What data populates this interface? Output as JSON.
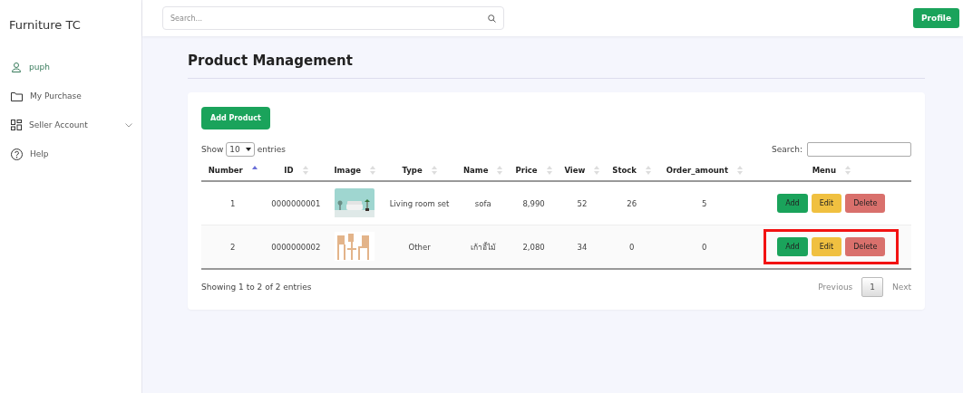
{
  "brand": "Furniture TC",
  "sidebar": {
    "items": [
      {
        "label": "puph",
        "selected": true,
        "expandable": false
      },
      {
        "label": "My Purchase",
        "selected": false,
        "expandable": false
      },
      {
        "label": "Seller Account",
        "selected": false,
        "expandable": true
      },
      {
        "label": "Help",
        "selected": false,
        "expandable": false
      }
    ]
  },
  "topbar": {
    "search_placeholder": "Search...",
    "profile_button": "Profile"
  },
  "page_title": "Product Management",
  "add_button": "Add Product",
  "length_menu": {
    "show": "Show",
    "value": "10",
    "entries": "entries"
  },
  "table_search_label": "Search:",
  "table": {
    "columns": [
      {
        "label": "Number",
        "sorted_ascending": true
      },
      {
        "label": "ID",
        "sorted_ascending": false
      },
      {
        "label": "Image",
        "sorted_ascending": false
      },
      {
        "label": "Type",
        "sorted_ascending": false
      },
      {
        "label": "Name",
        "sorted_ascending": false
      },
      {
        "label": "Price",
        "sorted_ascending": false
      },
      {
        "label": "View",
        "sorted_ascending": false
      },
      {
        "label": "Stock",
        "sorted_ascending": false
      },
      {
        "label": "Order_amount",
        "sorted_ascending": false
      },
      {
        "label": "Menu",
        "sorted_ascending": false
      }
    ],
    "rows": [
      {
        "number": "1",
        "id": "0000000001",
        "image": {
          "kind": "picture"
        },
        "type": "Living room set",
        "name": "sofa",
        "price": "8,990",
        "view": "52",
        "stock": "26",
        "order_amount": "5",
        "actions": [
          "Add",
          "Edit",
          "Delete"
        ],
        "highlighted": false
      },
      {
        "number": "2",
        "id": "0000000002",
        "image": {
          "kind": "picture"
        },
        "type": "Other",
        "name": "เก้าอี้ไม้",
        "price": "2,080",
        "view": "34",
        "stock": "0",
        "order_amount": "0",
        "actions": [
          "Add",
          "Edit",
          "Delete"
        ],
        "highlighted": true
      }
    ]
  },
  "info": "Showing 1 to 2 of 2 entries",
  "pagination": {
    "previous": "Previous",
    "pages": [
      {
        "label": "1",
        "selected": true
      }
    ],
    "next": "Next"
  }
}
